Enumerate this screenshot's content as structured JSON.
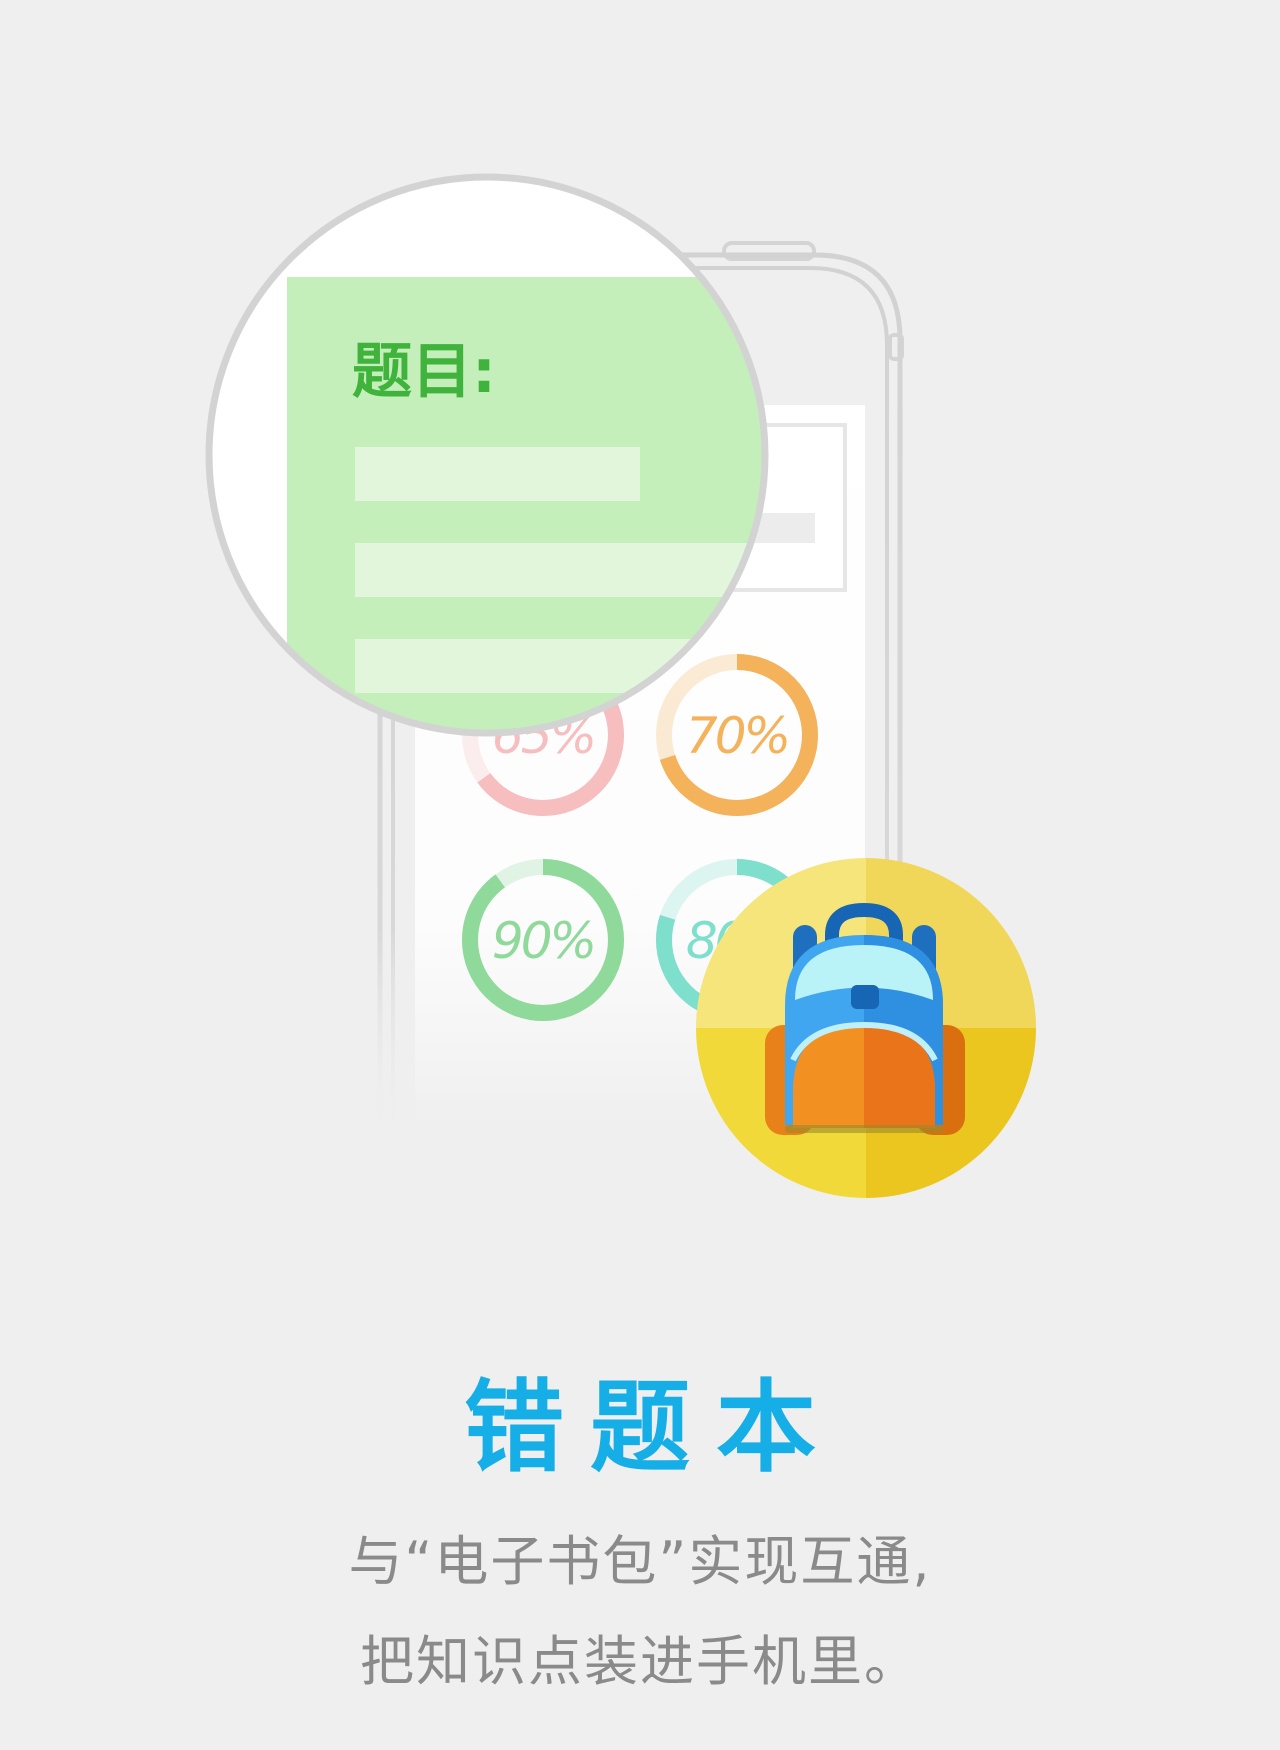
{
  "illustration": {
    "magnifier_heading": "题目:",
    "progress_rings": [
      {
        "label": "65%",
        "value": 0.65,
        "color": "#f4a9a9"
      },
      {
        "label": "70%",
        "value": 0.7,
        "color": "#f4b25a"
      },
      {
        "label": "90%",
        "value": 0.9,
        "color": "#8fd99a"
      },
      {
        "label": "80%",
        "value": 0.8,
        "color": "#7edfcc"
      }
    ],
    "badge_icon": "backpack-icon"
  },
  "feature": {
    "title": "错题本",
    "description_line1": "与“电子书包”实现互通,",
    "description_line2": "把知识点装进手机里。"
  },
  "colors": {
    "background": "#efefef",
    "title": "#16aee6",
    "description": "#8a8a8a",
    "magnifier_green": "#c4efbb",
    "badge_yellow": "#f2d93a"
  }
}
